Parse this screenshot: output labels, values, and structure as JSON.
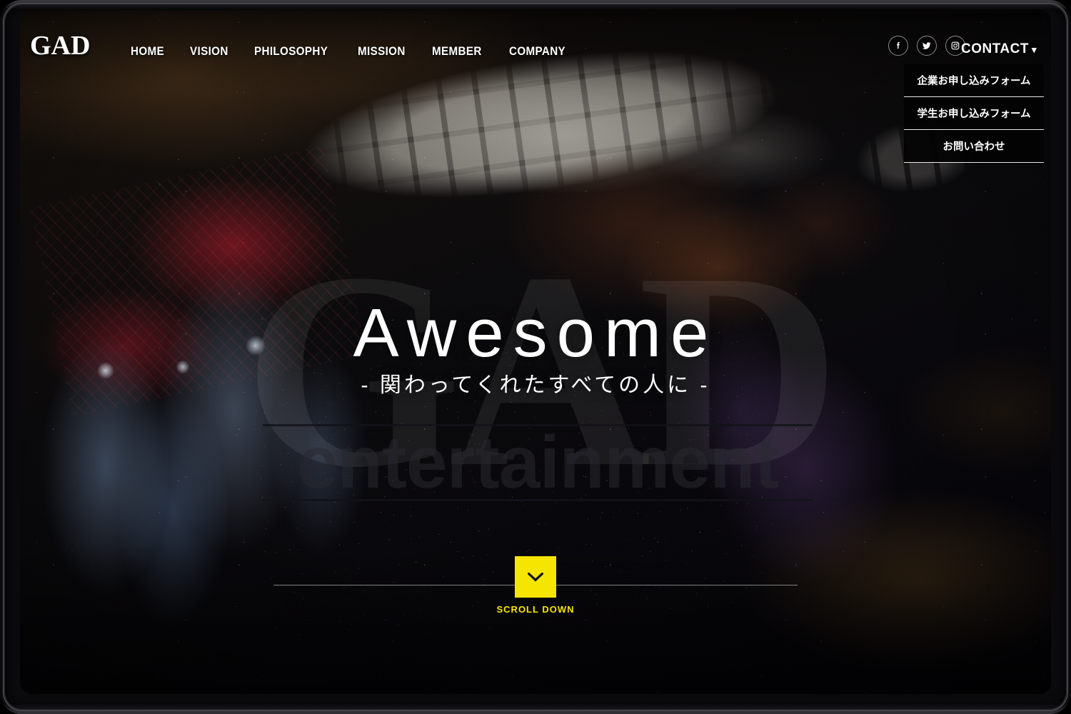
{
  "site": {
    "logo": "GAD",
    "watermark": "GAD"
  },
  "nav": {
    "items": [
      {
        "label": "HOME"
      },
      {
        "label": "VISION"
      },
      {
        "label": "PHILOSOPHY"
      },
      {
        "label": "MISSION"
      },
      {
        "label": "MEMBER"
      },
      {
        "label": "COMPANY"
      }
    ]
  },
  "socials": {
    "items": [
      {
        "icon": "facebook-icon",
        "label": "Facebook"
      },
      {
        "icon": "twitter-icon",
        "label": "Twitter"
      },
      {
        "icon": "instagram-icon",
        "label": "Instagram"
      }
    ]
  },
  "contact": {
    "toggle_label": "CONTACT",
    "caret": "▾",
    "menu_items": [
      {
        "label": "企業お申し込みフォーム"
      },
      {
        "label": "学生お申し込みフォーム"
      },
      {
        "label": "お問い合わせ"
      }
    ]
  },
  "hero": {
    "title": "Awesome",
    "subtitle": "- 関わってくれたすべての人に -",
    "band_word": "entertainment"
  },
  "scroll": {
    "label": "SCROLL DOWN",
    "icon": "chevron-down-icon"
  },
  "colors": {
    "accent_yellow": "#F5E500",
    "text_white": "#FFFFFF",
    "background_black": "#050406",
    "divider_white": "#E8E8E8"
  }
}
